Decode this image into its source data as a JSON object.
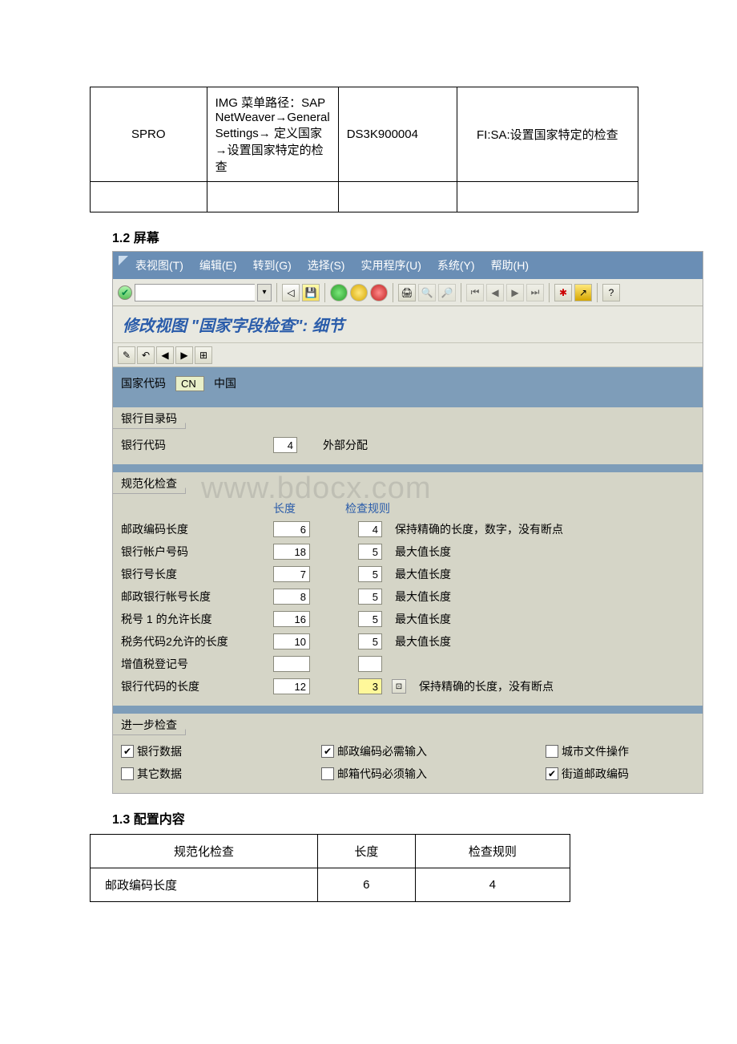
{
  "topTable": {
    "r1c1": "SPRO",
    "r1c2": "IMG 菜单路径：SAP NetWeaver→General Settings→ 定义国家→设置国家特定的检查",
    "r1c3": "DS3K900004",
    "r1c4": "FI:SA:设置国家特定的检查"
  },
  "heading12": "1.2 屏幕",
  "menubar": {
    "m1": "表视图(T)",
    "m2": "编辑(E)",
    "m3": "转到(G)",
    "m4": "选择(S)",
    "m5": "实用程序(U)",
    "m6": "系统(Y)",
    "m7": "帮助(H)"
  },
  "title": "修改视图 \"国家字段检查\": 细节",
  "country": {
    "label": "国家代码",
    "code": "CN",
    "name": "中国"
  },
  "group1": {
    "tab": "银行目录码",
    "label": "银行代码",
    "value": "4",
    "desc": "外部分配"
  },
  "watermark": "www.bdocx.com",
  "group2": {
    "tab": "规范化检查",
    "colLen": "长度",
    "colRule": "检查规则",
    "rows": [
      {
        "label": "邮政编码长度",
        "len": "6",
        "rule": "4",
        "desc": "保持精确的长度，数字，没有断点"
      },
      {
        "label": "银行帐户号码",
        "len": "18",
        "rule": "5",
        "desc": "最大值长度"
      },
      {
        "label": "银行号长度",
        "len": "7",
        "rule": "5",
        "desc": "最大值长度"
      },
      {
        "label": "邮政银行帐号长度",
        "len": "8",
        "rule": "5",
        "desc": "最大值长度"
      },
      {
        "label": "税号 1 的允许长度",
        "len": "16",
        "rule": "5",
        "desc": "最大值长度"
      },
      {
        "label": "税务代码2允许的长度",
        "len": "10",
        "rule": "5",
        "desc": "最大值长度"
      },
      {
        "label": "增值税登记号",
        "len": "",
        "rule": "",
        "desc": ""
      },
      {
        "label": "银行代码的长度",
        "len": "12",
        "rule": "3",
        "desc": "保持精确的长度，没有断点",
        "hl": true
      }
    ]
  },
  "group3": {
    "tab": "进一步检查",
    "r1c1": "银行数据",
    "r1c1chk": true,
    "r1c2": "邮政编码必需输入",
    "r1c2chk": true,
    "r1c3": "城市文件操作",
    "r1c3chk": false,
    "r2c1": "其它数据",
    "r2c1chk": false,
    "r2c2": "邮箱代码必须输入",
    "r2c2chk": false,
    "r2c3": "街道邮政编码",
    "r2c3chk": true
  },
  "heading13": "1.3 配置内容",
  "cfgTable": {
    "h1": "规范化检查",
    "h2": "长度",
    "h3": "检查规则",
    "r1c1": "邮政编码长度",
    "r1c2": "6",
    "r1c3": "4"
  }
}
